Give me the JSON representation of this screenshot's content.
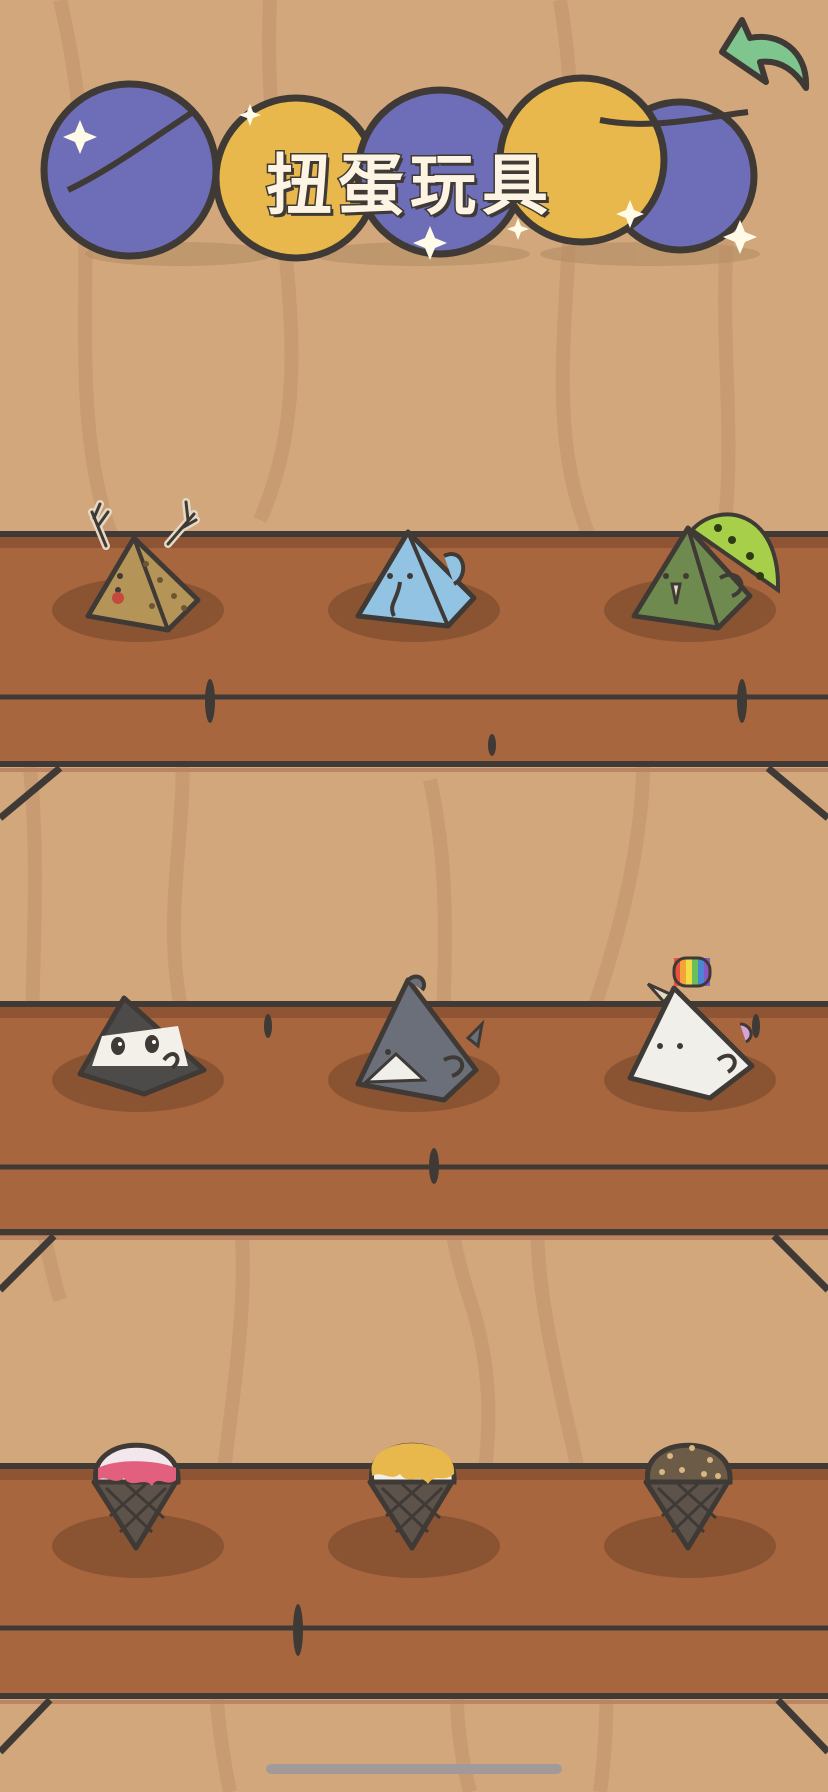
{
  "title": "扭蛋玩具",
  "shelves": [
    {
      "toys": [
        {
          "name": "deer"
        },
        {
          "name": "elephant"
        },
        {
          "name": "peacock"
        }
      ]
    },
    {
      "toys": [
        {
          "name": "panda"
        },
        {
          "name": "shark"
        },
        {
          "name": "unicorn"
        }
      ]
    },
    {
      "toys": [
        {
          "name": "strawberry-ice-cream"
        },
        {
          "name": "mango-ice-cream"
        },
        {
          "name": "chocolate-ice-cream"
        }
      ]
    }
  ],
  "icons": {
    "back": "back-arrow-icon"
  },
  "colors": {
    "wall": "#d2a77c",
    "shelf": "#a8663f",
    "outline": "#3f3a35",
    "capsule_purple": "#6d6eb7",
    "capsule_yellow": "#e8b84c",
    "back_arrow": "#7ec58e"
  }
}
